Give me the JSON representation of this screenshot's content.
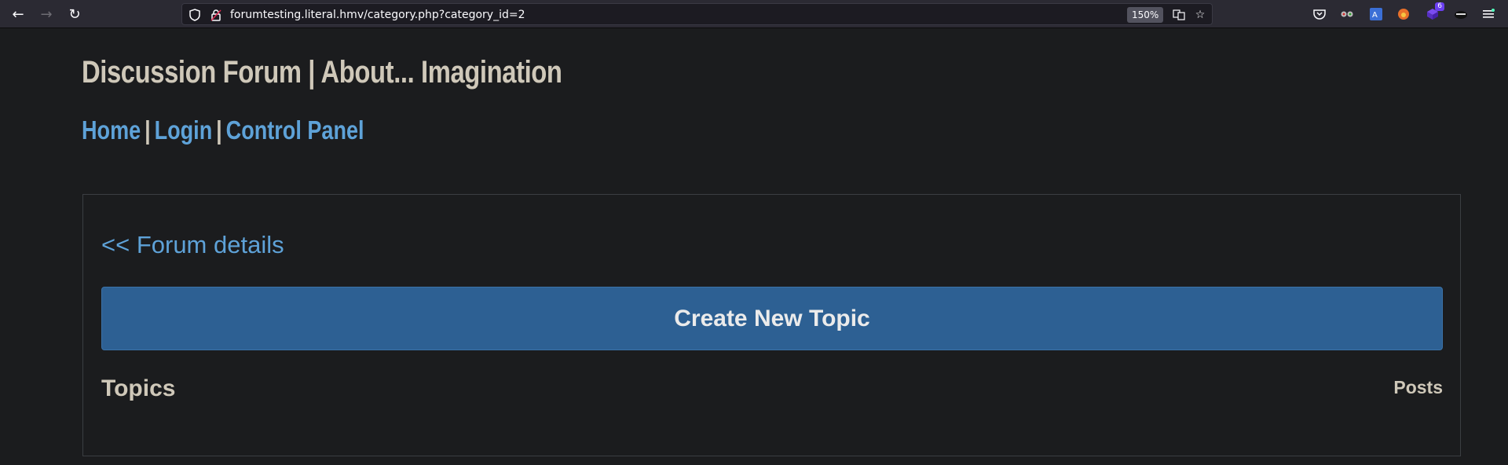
{
  "browser": {
    "url": "forumtesting.literal.hmv/category.php?category_id=2",
    "zoom": "150%",
    "extension_badge_count": "6",
    "icons": {
      "back": "back-arrow-icon",
      "forward": "forward-arrow-icon",
      "reload": "reload-icon",
      "shield": "tracking-protection-shield-icon",
      "lock": "insecure-lock-icon",
      "translate": "translate-icon",
      "bookmark": "bookmark-star-icon",
      "pocket": "pocket-icon",
      "menu": "hamburger-menu-icon"
    }
  },
  "site": {
    "title": "Discussion Forum | About... Imagination",
    "nav": {
      "home": "Home",
      "login": "Login",
      "control_panel": "Control Panel",
      "separator": "|"
    }
  },
  "main": {
    "back_link": "<< Forum details",
    "create_button": "Create New Topic",
    "topics_header": "Topics",
    "posts_header": "Posts"
  },
  "colors": {
    "page_bg": "#1b1c1e",
    "link": "#5ea2d8",
    "title_text": "#cfc8b9",
    "button_bg": "#2d6093"
  }
}
